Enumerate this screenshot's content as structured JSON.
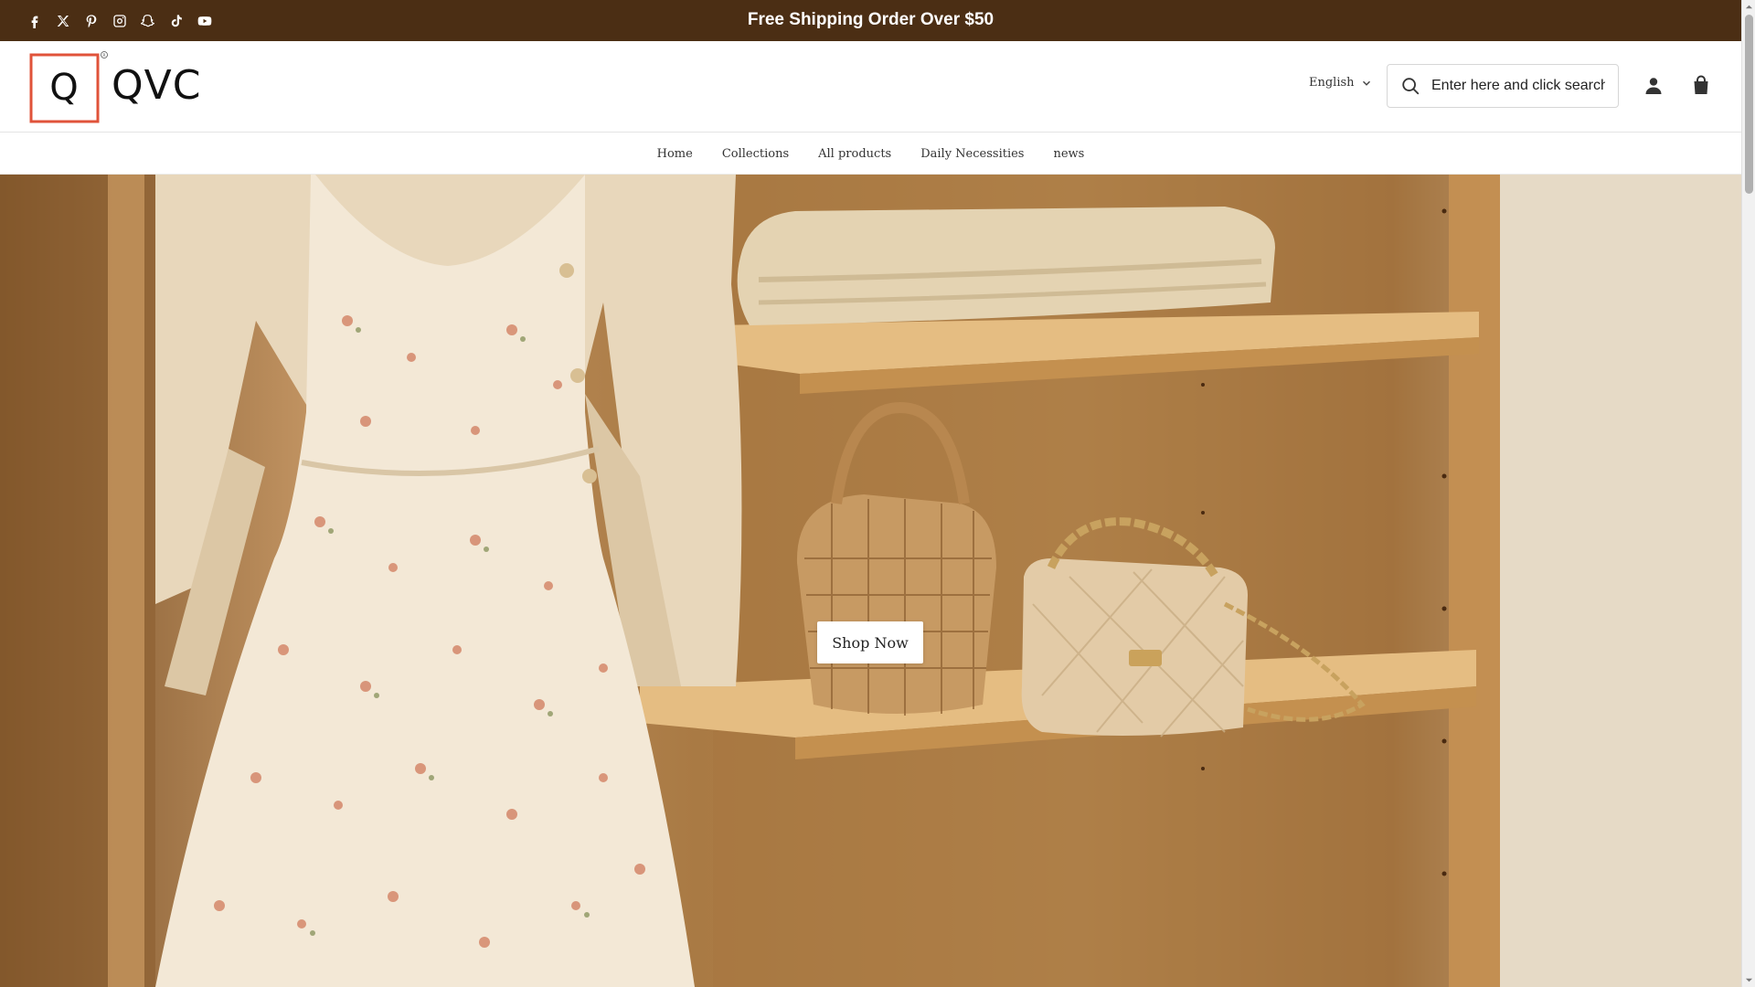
{
  "announcement": {
    "text": "Free Shipping Order Over $50"
  },
  "social_icons": [
    "facebook-icon",
    "x-twitter-icon",
    "pinterest-icon",
    "instagram-icon",
    "snapchat-icon",
    "tiktok-icon",
    "youtube-icon"
  ],
  "header": {
    "logo_text": "QVC",
    "logo_mark": "Q",
    "language": "English",
    "search": {
      "placeholder": "Enter here and click search",
      "value": ""
    }
  },
  "nav": {
    "items": [
      "Home",
      "Collections",
      "All products",
      "Daily Necessities",
      "news"
    ]
  },
  "hero": {
    "button_label": "Shop Now"
  },
  "colors": {
    "topbar": "#4b2e14",
    "logo_accent": "#e0533a",
    "text": "#333333"
  }
}
